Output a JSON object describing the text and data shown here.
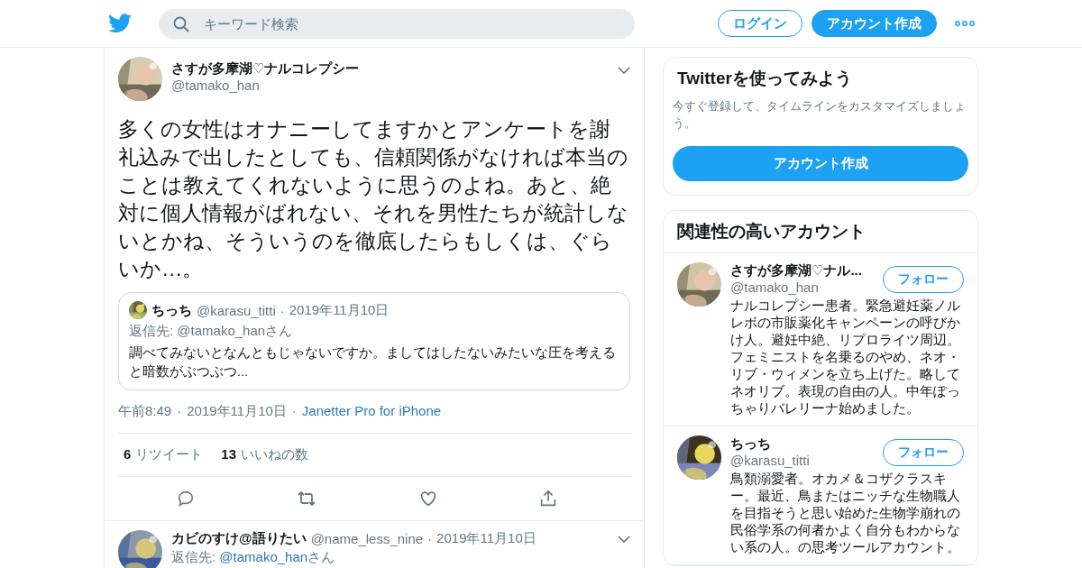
{
  "header": {
    "search": {
      "placeholder": "キーワード検索"
    },
    "login": "ログイン",
    "signup": "アカウント作成"
  },
  "tweet": {
    "name": "さすが多摩湖♡ナルコレプシー",
    "handle": "@tamako_han",
    "text": "多くの女性はオナニーしてますかとアンケートを謝礼込みで出したとしても、信頼関係がなければ本当のことは教えてくれないように思うのよね。あと、絶対に個人情報がばれない、それを男性たちが統計しないとかね、そういうのを徹底したらもしくは、ぐらいか…。",
    "quote": {
      "name": "ちっち",
      "handle": "@karasu_titti",
      "dot": "·",
      "date": "2019年11月10日",
      "reply_to": "返信先: @tamako_hanさん",
      "text": "調べてみないとなんともじゃないですか。ましてはしたないみたいな圧を考えると暗数がぶつぶつ..."
    },
    "meta": {
      "time": "午前8:49",
      "dot1": "·",
      "date": "2019年11月10日",
      "dot2": "·",
      "source": "Janetter Pro for iPhone"
    },
    "stats": [
      {
        "count": "6",
        "label": "リツイート"
      },
      {
        "count": "13",
        "label": "いいねの数"
      }
    ],
    "actions": [
      {
        "kind": "reply"
      },
      {
        "kind": "retweet"
      },
      {
        "kind": "like"
      },
      {
        "kind": "share"
      }
    ]
  },
  "next_tweet": {
    "name": "カビのすけ@語りたい",
    "handle": "@name_less_nine",
    "dot": "·",
    "date": "2019年11月10日",
    "reply_prefix": "返信先: ",
    "reply_handle": "@tamako_han",
    "reply_suffix": "さん"
  },
  "sidebar": {
    "signup_card": {
      "title": "Twitterを使ってみよう",
      "text": "今すぐ登録して、タイムラインをカスタマイズしましょう。",
      "button": "アカウント作成"
    },
    "related": {
      "title": "関連性の高いアカウント",
      "accounts": [
        {
          "name": "さすが多摩湖♡ナル...",
          "handle": "@tamako_han",
          "button": "フォロー",
          "bio": "ナルコレプシー患者。緊急避妊薬ノルレボの市販薬化キャンペーンの呼びかけ人。避妊中絶、リプロライツ周辺。フェミニストを名乗るのやめ、ネオ・リブ・ウィメンを立ち上げた。略してネオリブ。表現の自由の人。中年ぽっちゃりバレリーナ始めました。"
        },
        {
          "name": "ちっち",
          "handle": "@karasu_titti",
          "button": "フォロー",
          "bio": "鳥類溺愛者。オカメ＆コザクラスキー。最近、鳥またはニッチな生物職人を目指そうと思い始めた生物学崩れの民俗学系の何者かよく自分もわからない系の人。の思考ツールアカウント。"
        }
      ]
    }
  }
}
